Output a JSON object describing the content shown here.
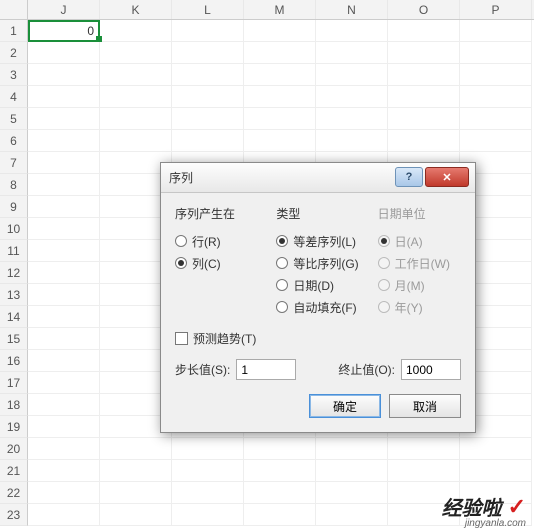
{
  "sheet": {
    "columns": [
      "J",
      "K",
      "L",
      "M",
      "N",
      "O",
      "P"
    ],
    "row_count": 23,
    "selected_cell_value": "0"
  },
  "dialog": {
    "title": "序列",
    "help_glyph": "?",
    "close_glyph": "✕",
    "group_series": {
      "label": "序列产生在",
      "rows_label": "行(R)",
      "cols_label": "列(C)",
      "selected": "cols"
    },
    "group_type": {
      "label": "类型",
      "arith_label": "等差序列(L)",
      "geom_label": "等比序列(G)",
      "date_label": "日期(D)",
      "auto_label": "自动填充(F)",
      "selected": "arith"
    },
    "group_dateunit": {
      "label": "日期单位",
      "day_label": "日(A)",
      "weekday_label": "工作日(W)",
      "month_label": "月(M)",
      "year_label": "年(Y)",
      "selected": "day"
    },
    "trend_label": "预测趋势(T)",
    "step_label": "步长值(S):",
    "step_value": "1",
    "stop_label": "终止值(O):",
    "stop_value": "1000",
    "ok_label": "确定",
    "cancel_label": "取消"
  },
  "watermark": {
    "text": "经验啦",
    "check": "✓",
    "url": "jingyanla.com"
  }
}
